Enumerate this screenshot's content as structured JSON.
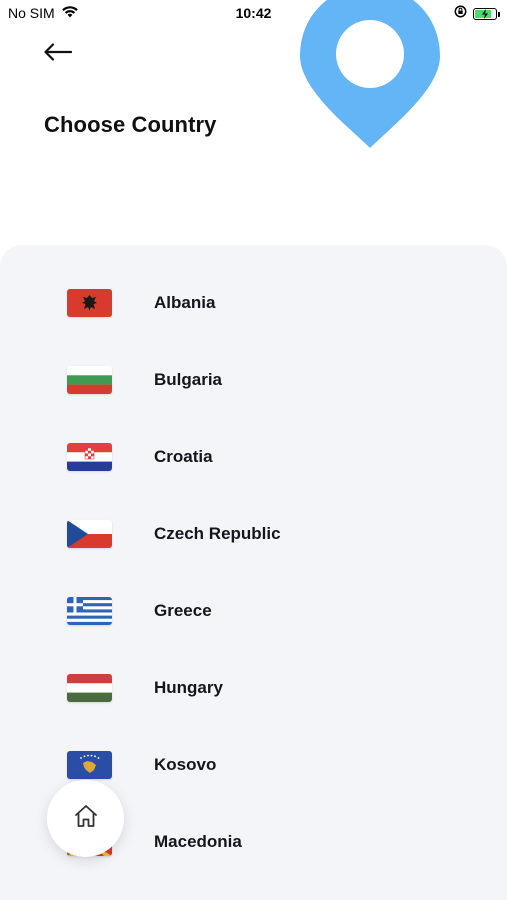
{
  "status_bar": {
    "carrier": "No SIM",
    "time": "10:42",
    "battery_level": 0.85,
    "battery_color": "#4cd964"
  },
  "header": {
    "back_icon": "arrow-left-icon",
    "title": "Choose Country",
    "decoration_icon": "location-pin-icon",
    "pin_color": "#64b5f6"
  },
  "countries": [
    {
      "name": "Albania",
      "flag": "albania-flag-icon"
    },
    {
      "name": "Bulgaria",
      "flag": "bulgaria-flag-icon"
    },
    {
      "name": "Croatia",
      "flag": "croatia-flag-icon"
    },
    {
      "name": "Czech Republic",
      "flag": "czech-flag-icon"
    },
    {
      "name": "Greece",
      "flag": "greece-flag-icon"
    },
    {
      "name": "Hungary",
      "flag": "hungary-flag-icon"
    },
    {
      "name": "Kosovo",
      "flag": "kosovo-flag-icon"
    },
    {
      "name": "Macedonia",
      "flag": "macedonia-flag-icon"
    }
  ],
  "fab": {
    "icon": "home-icon"
  },
  "colors": {
    "panel_background": "#f4f5f9",
    "text": "#15151f"
  }
}
